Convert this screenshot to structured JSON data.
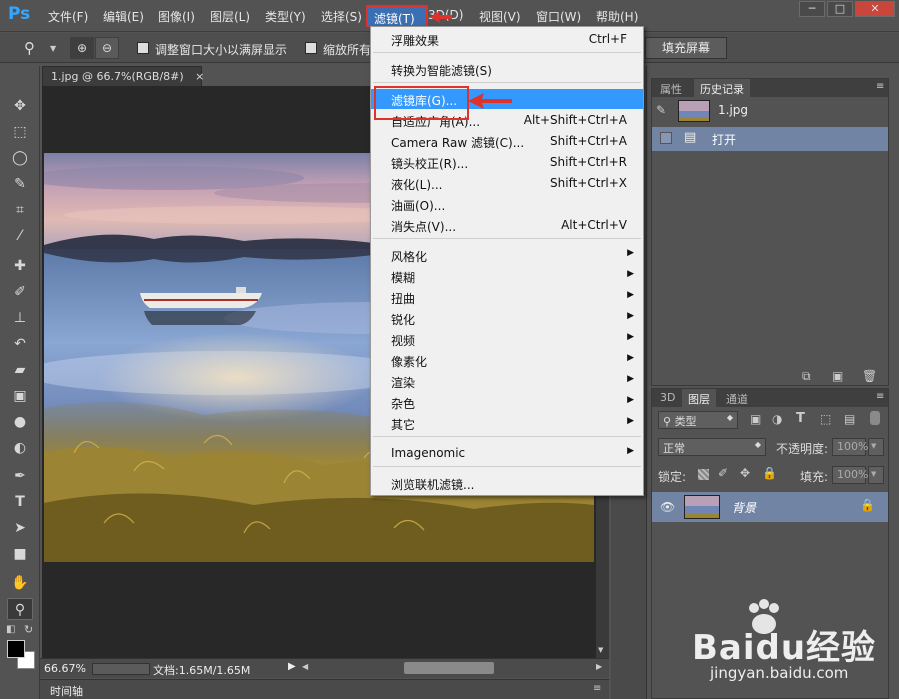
{
  "app": {
    "logo": "Ps"
  },
  "menubar": {
    "items": [
      "文件(F)",
      "编辑(E)",
      "图像(I)",
      "图层(L)",
      "类型(Y)",
      "选择(S)",
      "滤镜(T)",
      "3D(D)",
      "视图(V)",
      "窗口(W)",
      "帮助(H)"
    ],
    "active": "滤镜(T)"
  },
  "window_controls": {
    "minimize": "─",
    "restore": "□",
    "close": "✕"
  },
  "options_bar": {
    "resize_window_label": "调整窗口大小以满屏显示",
    "zoom_all_label": "缩放所有",
    "fill_screen_label": "填充屏幕"
  },
  "document": {
    "tab_title": "1.jpg @ 66.7%(RGB/8#)",
    "tab_close": "×",
    "zoom": "66.67%",
    "doc_info": "文档:1.65M/1.65M",
    "timeline_label": "时间轴"
  },
  "filter_menu": {
    "items": [
      {
        "label": "浮雕效果",
        "shortcut": "Ctrl+F"
      },
      {
        "label": "转换为智能滤镜(S)",
        "shortcut": ""
      },
      {
        "label": "滤镜库(G)...",
        "shortcut": "",
        "highlighted": true
      },
      {
        "label": "自适应广角(A)...",
        "shortcut": "Alt+Shift+Ctrl+A"
      },
      {
        "label": "Camera Raw 滤镜(C)...",
        "shortcut": "Shift+Ctrl+A"
      },
      {
        "label": "镜头校正(R)...",
        "shortcut": "Shift+Ctrl+R"
      },
      {
        "label": "液化(L)...",
        "shortcut": "Shift+Ctrl+X"
      },
      {
        "label": "油画(O)...",
        "shortcut": ""
      },
      {
        "label": "消失点(V)...",
        "shortcut": "Alt+Ctrl+V"
      },
      {
        "label": "风格化",
        "submenu": true
      },
      {
        "label": "模糊",
        "submenu": true
      },
      {
        "label": "扭曲",
        "submenu": true
      },
      {
        "label": "锐化",
        "submenu": true
      },
      {
        "label": "视频",
        "submenu": true
      },
      {
        "label": "像素化",
        "submenu": true
      },
      {
        "label": "渲染",
        "submenu": true
      },
      {
        "label": "杂色",
        "submenu": true
      },
      {
        "label": "其它",
        "submenu": true
      },
      {
        "label": "Imagenomic",
        "submenu": true
      },
      {
        "label": "浏览联机滤镜...",
        "shortcut": ""
      }
    ]
  },
  "history_panel": {
    "tabs": [
      "属性",
      "历史记录"
    ],
    "snapshot": "1.jpg",
    "states": [
      "打开"
    ]
  },
  "layers_panel": {
    "tabs": [
      "3D",
      "图层",
      "通道"
    ],
    "filter_kind": "类型",
    "blend_mode": "正常",
    "opacity_label": "不透明度:",
    "opacity_value": "100%",
    "lock_label": "锁定:",
    "fill_label": "填充:",
    "fill_value": "100%",
    "layers": [
      {
        "name": "背景",
        "visible": true,
        "locked": true
      }
    ]
  },
  "watermark": {
    "brand": "Baidu经验",
    "url": "jingyan.baidu.com"
  },
  "colors": {
    "menu_highlight": "#3399ff",
    "annotation_red": "#e0322d",
    "ps_blue": "#35a6ff"
  }
}
